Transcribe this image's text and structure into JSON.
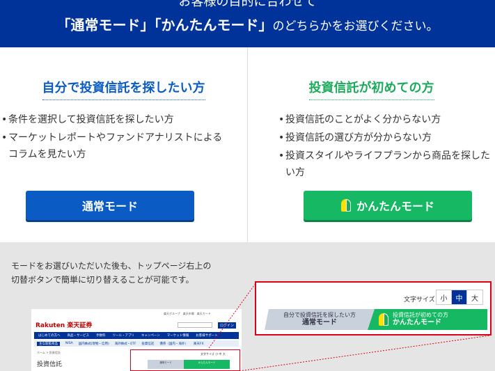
{
  "banner": {
    "line1": "お客様の目的に合わせて",
    "line2_part1": "「通常モード」「かんたんモード」",
    "line2_part2": "のどちらかをお選びください。"
  },
  "normal_mode": {
    "heading": "自分で投資信託を探したい方",
    "bullets": [
      "条件を選択して投資信託を探したい方",
      "マーケットレポートやファンドアナリストによるコラムを見たい方"
    ],
    "button_label": "通常モード"
  },
  "easy_mode": {
    "heading": "投資信託が初めての方",
    "bullets": [
      "投資信託のことがよく分からない方",
      "投資信託の選び方が分からない方",
      "投資スタイルやライフプランから商品を探したい方"
    ],
    "button_label": "かんたんモード"
  },
  "note": {
    "line1": "モードをお選びいただいた後も、トップページ右上の",
    "line2": "切替ボタンで簡単に切り替えることが可能です。"
  },
  "zoom_panel": {
    "font_size_label": "文字サイズ",
    "font_sizes": [
      "小",
      "中",
      "大"
    ],
    "active_font_size": "中",
    "normal_tab_sub": "自分で投資信託を探したい方",
    "normal_tab_main": "通常モード",
    "easy_tab_sub": "投資信託が初めての方",
    "easy_tab_main": "かんたんモード"
  },
  "mini_page": {
    "top_links": "楽天グループ　楽天市場　楽天カード",
    "logo": "Rakuten 楽天証券",
    "login": "ログイン",
    "nav_primary": [
      "はじめての方へ",
      "商品・サービス",
      "手数料",
      "ツール・アプリ",
      "キャンペーン",
      "マーケット情報",
      "お客様サポート"
    ],
    "nav_secondary_tag": "主な取扱商品",
    "nav_secondary": [
      "NISA",
      "国内株式(現物・信用)",
      "海外株式・ETF",
      "投資信託",
      "債券（国内・海外）",
      "楽天FX"
    ],
    "breadcrumb": "ホーム > 投資信託",
    "page_title": "投資信託",
    "mini_font_size": "文字サイズ 小 中 大",
    "mini_normal": "通常モード",
    "mini_easy": "かんたんモード"
  },
  "colors": {
    "banner_bg": "#003399",
    "normal_blue": "#0a5bc4",
    "easy_green": "#17b864",
    "highlight_red": "#d9001b"
  }
}
